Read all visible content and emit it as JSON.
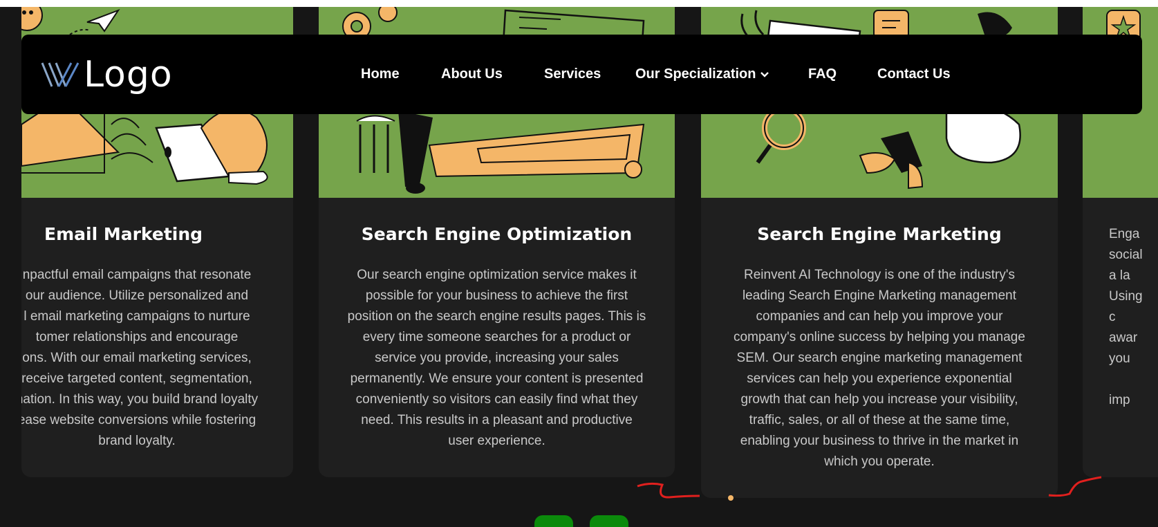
{
  "navbar": {
    "logo_text": "Logo",
    "links": [
      {
        "label": "Home"
      },
      {
        "label": "About Us"
      },
      {
        "label": "Services"
      },
      {
        "label": "Our Specialization"
      },
      {
        "label": "FAQ"
      },
      {
        "label": "Contact Us"
      }
    ]
  },
  "cards": [
    {
      "title": "Email Marketing",
      "lines": [
        "npactful email campaigns that resonate",
        "our audience. Utilize personalized and",
        "l email marketing campaigns to nurture",
        "tomer relationships and encourage",
        "ons. With our email marketing services,",
        "receive targeted content, segmentation,",
        "nation. In this way, you build brand loyalty",
        "ease website conversions while fostering",
        "brand loyalty."
      ]
    },
    {
      "title": "Search Engine Optimization",
      "lines": [
        "Our search engine optimization service makes it",
        "possible for your business to achieve the first",
        "position on the search engine results pages. This is",
        "every time someone searches for a product or",
        "service you provide, increasing your sales",
        "permanently. We ensure your content is presented",
        "conveniently so visitors can easily find what they",
        "need. This results in a pleasant and productive",
        "user experience."
      ]
    },
    {
      "title": "Search Engine Marketing",
      "lines": [
        "Reinvent AI Technology is one of the industry's",
        "leading Search Engine Marketing management",
        "companies and can help you improve your",
        "company's online success by helping you manage",
        "SEM. Our search engine marketing management",
        "services can help you experience exponential",
        "growth that can help you increase your visibility,",
        "traffic, sales, or all of these at the same time,",
        "enabling your business to thrive in the market in",
        "which you operate."
      ]
    },
    {
      "title": "",
      "lines": [
        "Enga",
        "social",
        "a la",
        "Using",
        "c",
        "awar",
        "you",
        "",
        "imp"
      ]
    }
  ],
  "colors": {
    "illustration_bg": "#76a44b",
    "card_bg": "#1f1f1f",
    "page_bg": "#161616",
    "navbar_bg": "#000000",
    "accent_orange": "#f4b668",
    "pagination_green": "#0b8a0b",
    "scribble_red": "#e0201e"
  }
}
